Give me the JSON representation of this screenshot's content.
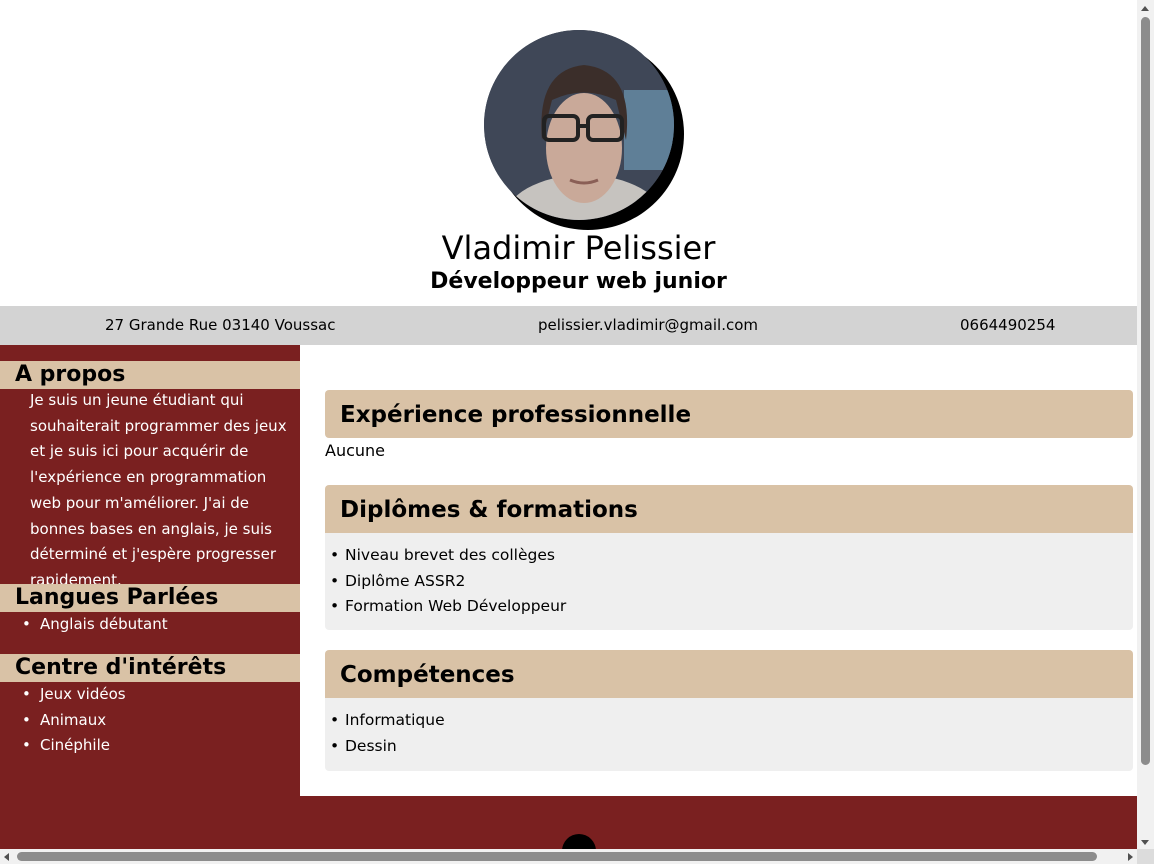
{
  "header": {
    "name": "Vladimir Pelissier",
    "job_title": "Développeur web junior"
  },
  "contact": {
    "address": "27 Grande Rue 03140 Voussac",
    "email": "pelissier.vladimir@gmail.com",
    "phone": "0664490254"
  },
  "sidebar": {
    "about": {
      "heading": "A propos",
      "text": "Je suis un jeune étudiant qui souhaiterait programmer des jeux et je suis ici pour acquérir de l'expérience en programmation web pour m'améliorer. J'ai de bonnes bases en anglais, je suis déterminé et j'espère progresser rapidement."
    },
    "languages": {
      "heading": "Langues Parlées",
      "items": [
        "Anglais débutant"
      ]
    },
    "interests": {
      "heading": "Centre d'intérêts",
      "items": [
        "Jeux vidéos",
        "Animaux",
        "Cinéphile"
      ]
    }
  },
  "main": {
    "experience": {
      "heading": "Expérience professionnelle",
      "text": "Aucune"
    },
    "education": {
      "heading": "Diplômes & formations",
      "items": [
        "Niveau brevet des collèges",
        "Diplôme ASSR2",
        "Formation Web Développeur"
      ]
    },
    "skills": {
      "heading": "Compétences",
      "items": [
        "Informatique",
        "Dessin"
      ]
    }
  },
  "colors": {
    "sidebar_bg": "#7a2020",
    "section_header_bg": "#d9c2a6",
    "contact_bar_bg": "#d3d3d3",
    "card_body_bg": "#efefef"
  },
  "footer": {
    "icon": "github-icon"
  }
}
